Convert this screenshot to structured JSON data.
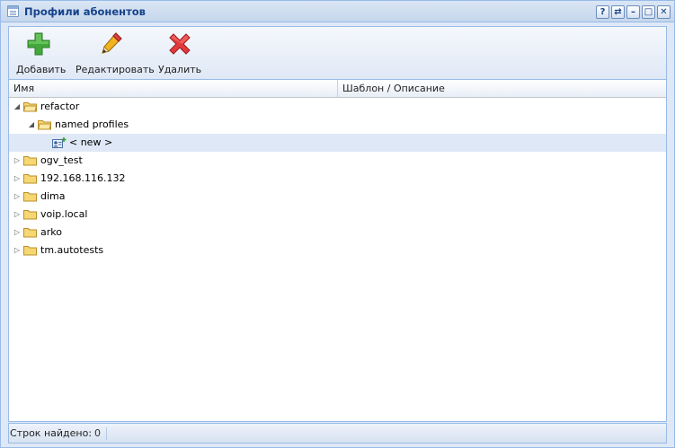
{
  "window": {
    "title": "Профили абонентов",
    "buttons": [
      "?",
      "⇄",
      "–",
      "□",
      "✕"
    ]
  },
  "toolbar": {
    "add_label": "Добавить",
    "edit_label": "Редактировать",
    "delete_label": "Удалить"
  },
  "grid": {
    "columns": [
      "Имя",
      "Шаблон / Описание"
    ],
    "rows": [
      {
        "label": "refactor",
        "level": 0,
        "expanded": true,
        "type": "folder"
      },
      {
        "label": "named profiles",
        "level": 1,
        "expanded": true,
        "type": "folder"
      },
      {
        "label": "< new >",
        "level": 2,
        "type": "profile",
        "selected": true
      },
      {
        "label": "ogv_test",
        "level": 0,
        "expanded": false,
        "type": "folder"
      },
      {
        "label": "192.168.116.132",
        "level": 0,
        "expanded": false,
        "type": "folder"
      },
      {
        "label": "dima",
        "level": 0,
        "expanded": false,
        "type": "folder"
      },
      {
        "label": "voip.local",
        "level": 0,
        "expanded": false,
        "type": "folder"
      },
      {
        "label": "arko",
        "level": 0,
        "expanded": false,
        "type": "folder"
      },
      {
        "label": "tm.autotests",
        "level": 0,
        "expanded": false,
        "type": "folder"
      }
    ]
  },
  "statusbar": {
    "label": "Строк найдено:",
    "count": "0"
  },
  "colors": {
    "title_text": "#15428b",
    "border": "#99bbe8",
    "selection": "#dfe8f6"
  }
}
